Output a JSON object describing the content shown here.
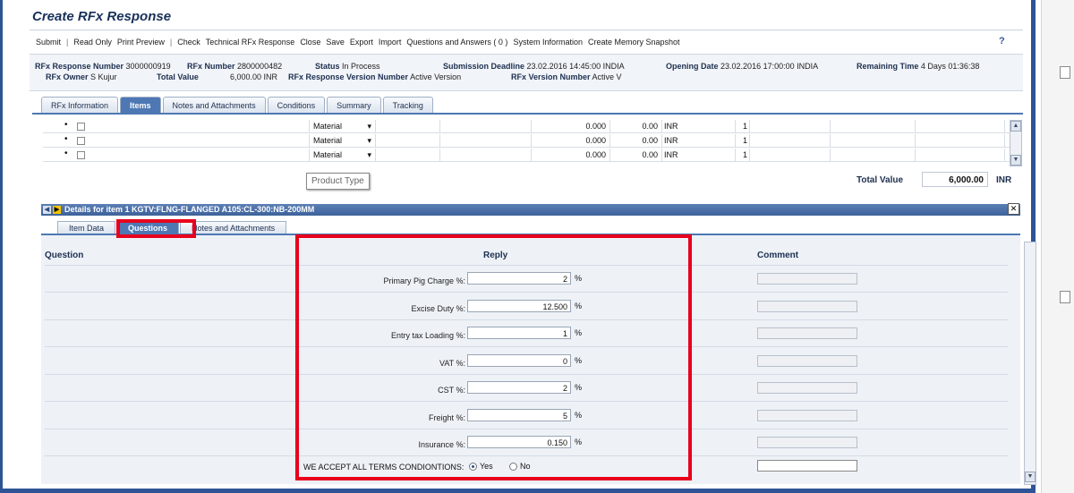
{
  "page": {
    "title": "Create RFx Response"
  },
  "toolbar": {
    "items": [
      "Submit",
      "|",
      "Read Only",
      "Print Preview",
      "|",
      "Check",
      "Technical RFx Response",
      "Close",
      "Save",
      "Export",
      "Import",
      "Questions and Answers ( 0 )",
      "System Information",
      "Create Memory Snapshot"
    ]
  },
  "header": {
    "rfx_response_number_label": "RFx Response Number",
    "rfx_response_number": "3000000919",
    "rfx_number_label": "RFx Number",
    "rfx_number": "2800000482",
    "status_label": "Status",
    "status": "In Process",
    "submission_deadline_label": "Submission Deadline",
    "submission_deadline": "23.02.2016 14:45:00 INDIA",
    "opening_date_label": "Opening Date",
    "opening_date": "23.02.2016 17:00:00 INDIA",
    "remaining_time_label": "Remaining Time",
    "remaining_time": "4 Days 01:36:38",
    "rfx_owner_label": "RFx Owner",
    "rfx_owner": "S Kujur",
    "total_value_label": "Total Value",
    "total_value": "6,000.00 INR",
    "response_version_label": "RFx Response Version Number",
    "response_version": "Active Version",
    "rfx_version_label": "RFx Version Number",
    "rfx_version": "Active V"
  },
  "tabs": [
    "RFx Information",
    "Items",
    "Notes and Attachments",
    "Conditions",
    "Summary",
    "Tracking"
  ],
  "items_grid": {
    "rows": [
      {
        "bullet": "•",
        "type": "Material",
        "qty": "0.000",
        "price": "0.00",
        "currency": "INR",
        "unit": "1"
      },
      {
        "bullet": "•",
        "type": "Material",
        "qty": "0.000",
        "price": "0.00",
        "currency": "INR",
        "unit": "1"
      },
      {
        "bullet": "•",
        "type": "Material",
        "qty": "0.000",
        "price": "0.00",
        "currency": "INR",
        "unit": "1"
      }
    ],
    "tooltip": "Product Type",
    "total_label": "Total Value",
    "total_value": "6,000.00",
    "total_currency": "INR"
  },
  "details": {
    "title": "Details for item 1  KGTV:FLNG-FLANGED A105:CL-300:NB-200MM",
    "subtabs": [
      "Item Data",
      "Questions",
      "Notes and Attachments"
    ]
  },
  "questions": {
    "col_question": "Question",
    "col_reply": "Reply",
    "col_comment": "Comment",
    "rows": [
      {
        "label": "Primary Pig Charge %:",
        "value": "2",
        "unit": "%"
      },
      {
        "label": "Excise Duty %:",
        "value": "12.500",
        "unit": "%"
      },
      {
        "label": "Entry tax Loading %:",
        "value": "1",
        "unit": "%"
      },
      {
        "label": "VAT %:",
        "value": "0",
        "unit": "%"
      },
      {
        "label": "CST %:",
        "value": "2",
        "unit": "%"
      },
      {
        "label": "Freight %:",
        "value": "5",
        "unit": "%"
      },
      {
        "label": "Insurance %:",
        "value": "0.150",
        "unit": "%"
      }
    ],
    "terms_label": "WE ACCEPT ALL TERMS CONDIONTIONS:",
    "yes_label": "Yes",
    "no_label": "No"
  },
  "colors": {
    "accent": "#4e78b3",
    "highlight": "#e8001c",
    "frame": "#2f5496"
  }
}
